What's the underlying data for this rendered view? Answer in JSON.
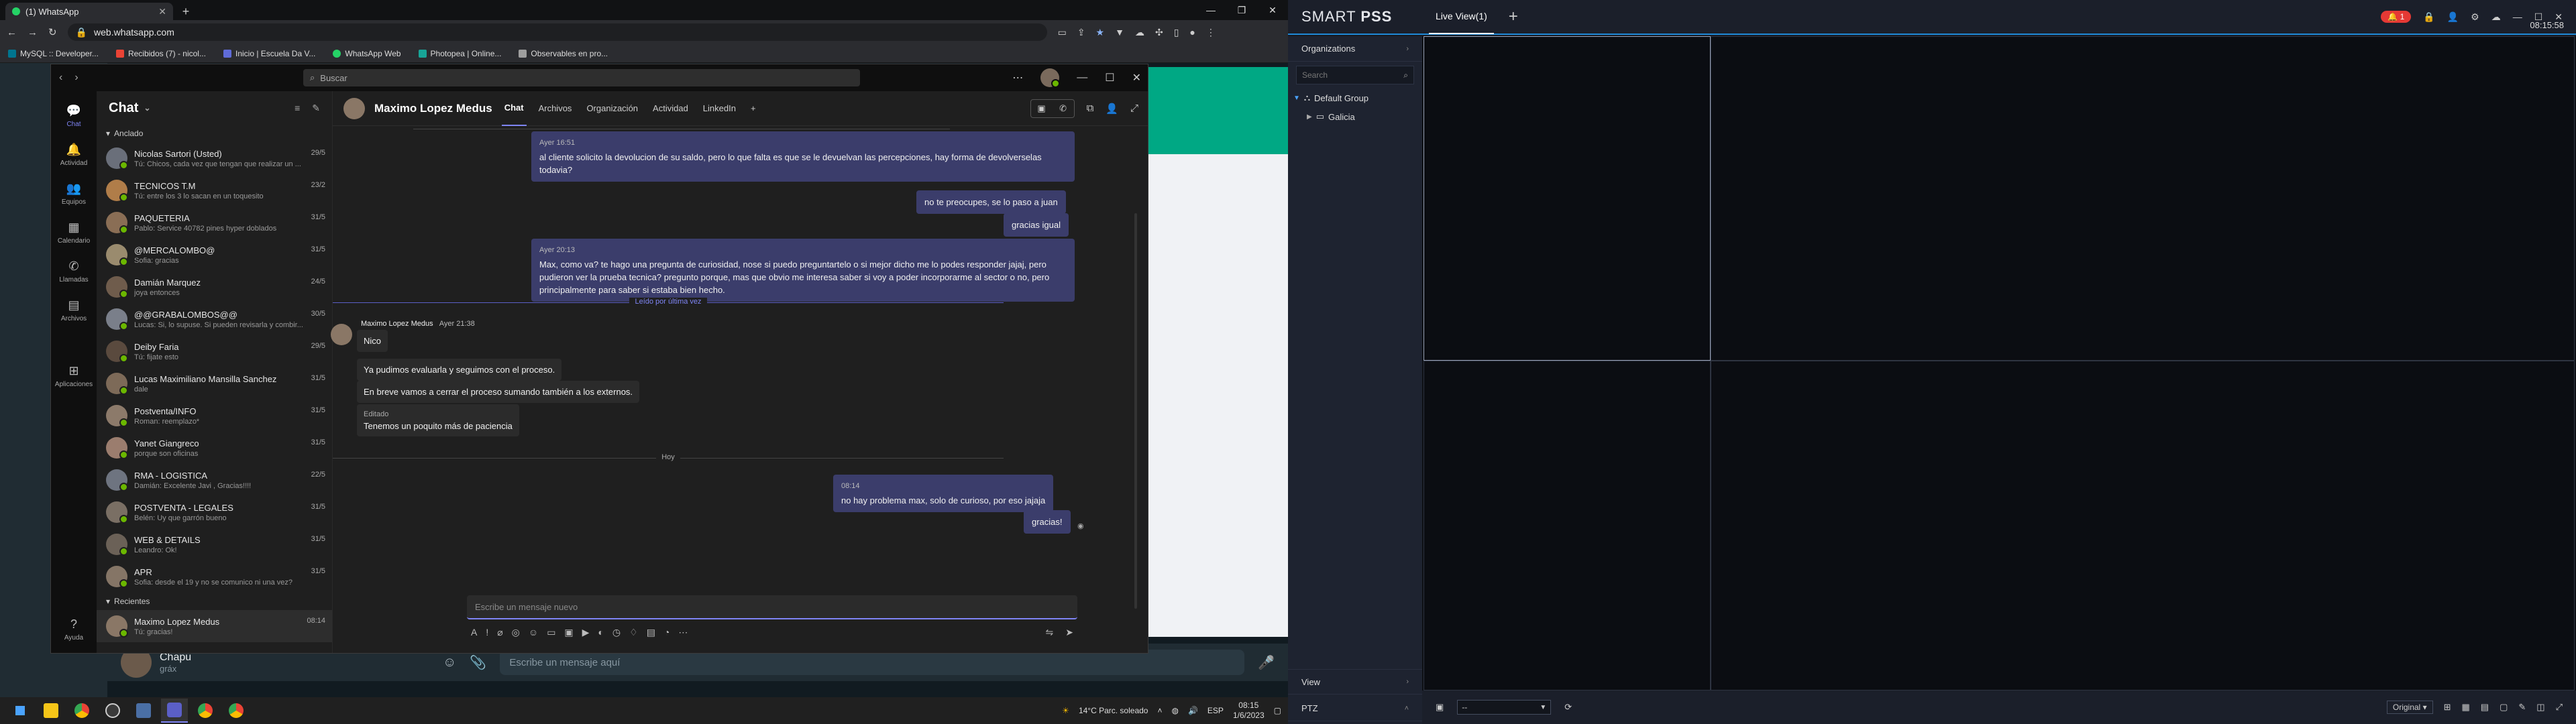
{
  "browser": {
    "tab_title": "(1) WhatsApp",
    "url": "web.whatsapp.com",
    "bookmarks": [
      "MySQL :: Developer...",
      "Recibidos (7) - nicol...",
      "Inicio | Escuela Da V...",
      "WhatsApp Web",
      "Photopea | Online...",
      "Observables en pro..."
    ]
  },
  "whatsapp": {
    "contact_name": "Chapu",
    "contact_status": "gráx",
    "message_placeholder": "Escribe un mensaje aquí"
  },
  "teams": {
    "search_placeholder": "Buscar",
    "rail": [
      {
        "label": "Chat",
        "icon": "chat-icon"
      },
      {
        "label": "Actividad",
        "icon": "bell-icon"
      },
      {
        "label": "Equipos",
        "icon": "teams-icon"
      },
      {
        "label": "Calendario",
        "icon": "calendar-icon"
      },
      {
        "label": "Llamadas",
        "icon": "phone-icon"
      },
      {
        "label": "Archivos",
        "icon": "file-icon"
      },
      {
        "label": "Aplicaciones",
        "icon": "apps-icon"
      }
    ],
    "rail_help": "Ayuda",
    "list_title": "Chat",
    "section_pinned": "Anclado",
    "section_recent": "Recientes",
    "pinned": [
      {
        "name": "Nicolas Sartori (Usted)",
        "preview": "Tú: Chicos, cada vez que tengan que realizar un ...",
        "date": "29/5",
        "color": "#6a6f7a"
      },
      {
        "name": "TECNICOS T.M",
        "preview": "Tú: entre los 3 lo sacan en un toquesito",
        "date": "23/2",
        "color": "#b07d49"
      },
      {
        "name": "PAQUETERIA",
        "preview": "Pablo: Service 40782 pines hyper doblados",
        "date": "31/5",
        "color": "#8a6e55"
      },
      {
        "name": "@MERCALOMBO@",
        "preview": "Sofia: gracias",
        "date": "31/5",
        "color": "#9a8b6e"
      },
      {
        "name": "Damián Marquez",
        "preview": "joya entonces",
        "date": "24/5",
        "color": "#6f5c4c"
      },
      {
        "name": "@@GRABALOMBOS@@",
        "preview": "Lucas: Si, lo supuse. Si pueden revisarla y combir...",
        "date": "30/5",
        "color": "#7a7f8a"
      },
      {
        "name": "Deiby Faria",
        "preview": "Tú: fijate esto",
        "date": "29/5",
        "color": "#5a4a3e"
      },
      {
        "name": "Lucas Maximiliano Mansilla Sanchez",
        "preview": "dale",
        "date": "31/5",
        "color": "#7d6a58"
      },
      {
        "name": "Postventa/INFO",
        "preview": "Roman: reemplazo*",
        "date": "31/5",
        "color": "#8c7a6a"
      },
      {
        "name": "Yanet Giangreco",
        "preview": "porque son oficinas",
        "date": "31/5",
        "color": "#9b7d6e"
      },
      {
        "name": "RMA - LOGISTICA",
        "preview": "Damián: Excelente Javi , Gracias!!!!",
        "date": "22/5",
        "color": "#6e7480"
      },
      {
        "name": "POSTVENTA - LEGALES",
        "preview": "Belén: Uy que garrón bueno",
        "date": "31/5",
        "color": "#7a6f64"
      },
      {
        "name": "WEB & DETAILS",
        "preview": "Leandro: Ok!",
        "date": "31/5",
        "color": "#6b6157"
      },
      {
        "name": "APR",
        "preview": "Sofia: desde el 19 y no se comunico ni una vez?",
        "date": "31/5",
        "color": "#857566"
      }
    ],
    "recent": [
      {
        "name": "Maximo Lopez Medus",
        "preview": "Tú: gracias!",
        "date": "08:14",
        "color": "#8a7766"
      }
    ],
    "header": {
      "name": "Maximo Lopez Medus",
      "tabs": [
        "Chat",
        "Archivos",
        "Organización",
        "Actividad",
        "LinkedIn"
      ]
    },
    "messages": {
      "m1_meta": "Ayer 16:51",
      "m1_text": "al cliente solicito la devolucion de su saldo, pero lo que falta es que se le devuelvan las percepciones, hay forma de devolverselas todavia?",
      "m2_text": "no te preocupes, se lo paso a juan",
      "m3_text": "gracias igual",
      "m4_meta": "Ayer 20:13",
      "m4_text": "Max, como va? te hago una pregunta de curiosidad, nose si puedo preguntartelo o si mejor dicho me lo podes responder jajaj, pero pudieron ver la prueba tecnica? pregunto porque, mas que obvio me interesa saber si voy a poder incorporarme al sector o no, pero principalmente para saber si estaba bien hecho.",
      "read_label": "Leído por última vez",
      "o_name": "Maximo Lopez Medus",
      "o_time": "Ayer 21:38",
      "o1": "Nico",
      "o2": "Ya pudimos evaluarla y seguimos con el proceso.",
      "o3": "En breve vamos a cerrar el proceso sumando también a los externos.",
      "o4_edited": "Editado",
      "o4": "Tenemos un poquito más de paciencia",
      "today_label": "Hoy",
      "m5_meta": "08:14",
      "m5_text": "no hay problema max, solo de curioso, por eso jajaja",
      "m6_text": "gracias!"
    },
    "compose_placeholder": "Escribe un mensaje nuevo"
  },
  "taskbar_left": {
    "weather": "14°C  Parc. soleado",
    "lang": "ESP",
    "time": "08:15",
    "date": "1/6/2023"
  },
  "smartpss": {
    "logo_light": "SMART ",
    "logo_bold": "PSS",
    "tab": "Live View(1)",
    "alarm_count": "1",
    "time": "08:15:58",
    "organizations": "Organizations",
    "search_placeholder": "Search",
    "tree_root": "Default Group",
    "tree_child": "Galicia",
    "view_label": "View",
    "ptz_label": "PTZ",
    "dropdown_value": "--",
    "original": "Original"
  }
}
